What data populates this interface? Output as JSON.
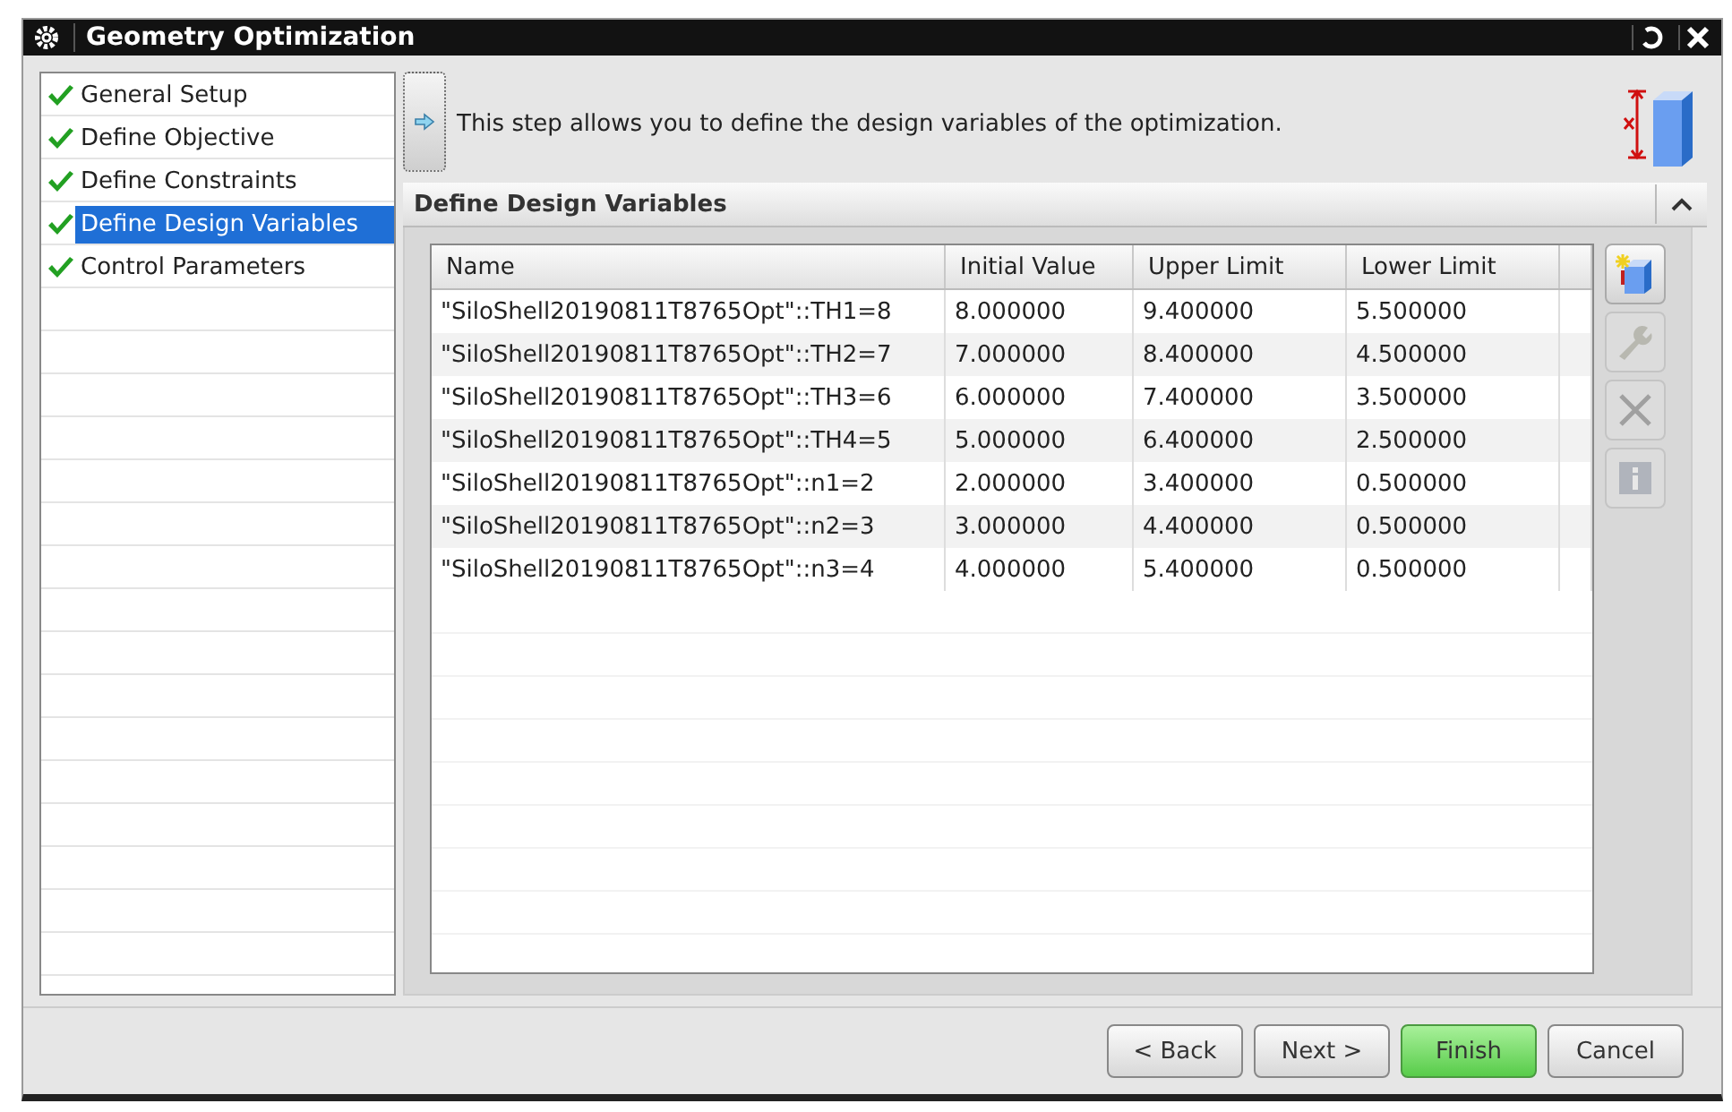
{
  "window": {
    "title": "Geometry Optimization"
  },
  "steps": [
    {
      "label": "General Setup",
      "checked": true,
      "selected": false
    },
    {
      "label": "Define Objective",
      "checked": true,
      "selected": false
    },
    {
      "label": "Define Constraints",
      "checked": true,
      "selected": false
    },
    {
      "label": "Define Design Variables",
      "checked": true,
      "selected": true
    },
    {
      "label": "Control Parameters",
      "checked": true,
      "selected": false
    }
  ],
  "description": "This step allows you to define the design variables of the optimization.",
  "section": {
    "title": "Define Design Variables",
    "expanded": true
  },
  "table": {
    "columns": [
      "Name",
      "Initial Value",
      "Upper Limit",
      "Lower Limit"
    ],
    "rows": [
      [
        "\"SiloShell20190811T8765Opt\"::TH1=8",
        "8.000000",
        "9.400000",
        "5.500000"
      ],
      [
        "\"SiloShell20190811T8765Opt\"::TH2=7",
        "7.000000",
        "8.400000",
        "4.500000"
      ],
      [
        "\"SiloShell20190811T8765Opt\"::TH3=6",
        "6.000000",
        "7.400000",
        "3.500000"
      ],
      [
        "\"SiloShell20190811T8765Opt\"::TH4=5",
        "5.000000",
        "6.400000",
        "2.500000"
      ],
      [
        "\"SiloShell20190811T8765Opt\"::n1=2",
        "2.000000",
        "3.400000",
        "0.500000"
      ],
      [
        "\"SiloShell20190811T8765Opt\"::n2=3",
        "3.000000",
        "4.400000",
        "0.500000"
      ],
      [
        "\"SiloShell20190811T8765Opt\"::n3=4",
        "4.000000",
        "5.400000",
        "0.500000"
      ]
    ]
  },
  "tools": [
    {
      "kind": "new",
      "disabled": false
    },
    {
      "kind": "edit",
      "disabled": true
    },
    {
      "kind": "delete",
      "disabled": true
    },
    {
      "kind": "info",
      "disabled": true
    }
  ],
  "buttons": [
    {
      "label": "< Back",
      "kind": "normal"
    },
    {
      "label": "Next >",
      "kind": "normal"
    },
    {
      "label": "Finish",
      "kind": "primary"
    },
    {
      "label": "Cancel",
      "kind": "normal"
    }
  ]
}
